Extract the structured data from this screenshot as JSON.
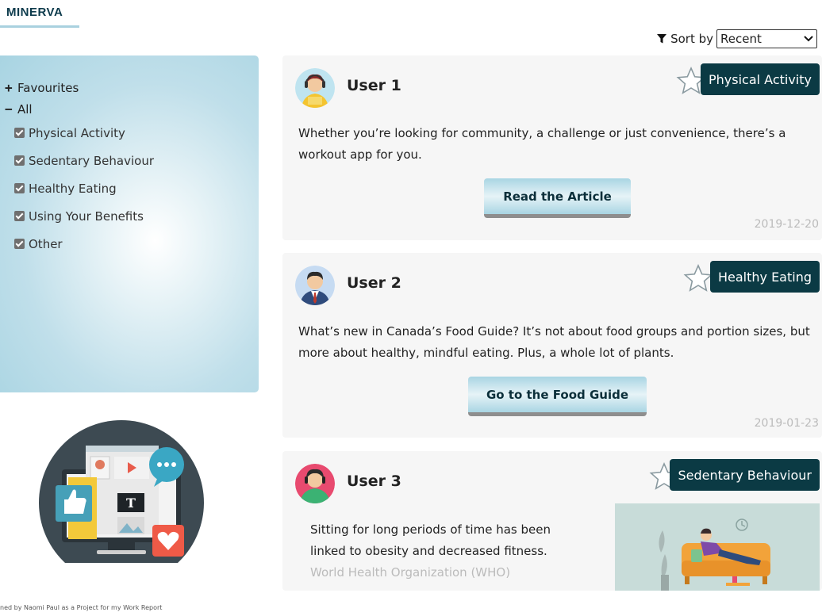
{
  "header": {
    "brand": "MINERVA"
  },
  "sort": {
    "label": "Sort by",
    "selected": "Recent",
    "icon": "filter-icon"
  },
  "sidebar": {
    "favourites": "Favourites",
    "all": "All",
    "categories": [
      {
        "label": "Physical Activity",
        "checked": true
      },
      {
        "label": "Sedentary Behaviour",
        "checked": true
      },
      {
        "label": "Healthy Eating",
        "checked": true
      },
      {
        "label": "Using Your Benefits",
        "checked": true
      },
      {
        "label": "Other",
        "checked": true
      }
    ]
  },
  "posts": [
    {
      "user": "User 1",
      "tag": "Physical Activity",
      "text": "Whether you’re looking for community, a challenge or just convenience, there’s a workout app for you.",
      "button": "Read the Article",
      "date": "2019-12-20"
    },
    {
      "user": "User 2",
      "tag": "Healthy Eating",
      "text": "What’s new in Canada’s Food Guide? It’s not about food groups and portion sizes, but more about healthy, mindful eating. Plus, a whole lot of plants.",
      "button": "Go to the Food Guide",
      "date": "2019-01-23"
    },
    {
      "user": "User 3",
      "tag": "Sedentary Behaviour",
      "text": "Sitting for long periods of time has been linked to obesity and decreased fitness.",
      "source": "World Health Organization (WHO)"
    }
  ],
  "footer": {
    "credit": "ned by Naomi Paul as a Project for my Work Report"
  },
  "colors": {
    "tag_bg": "#0b3a44",
    "accent": "#a9d1df",
    "button": "#a9d5e3"
  }
}
